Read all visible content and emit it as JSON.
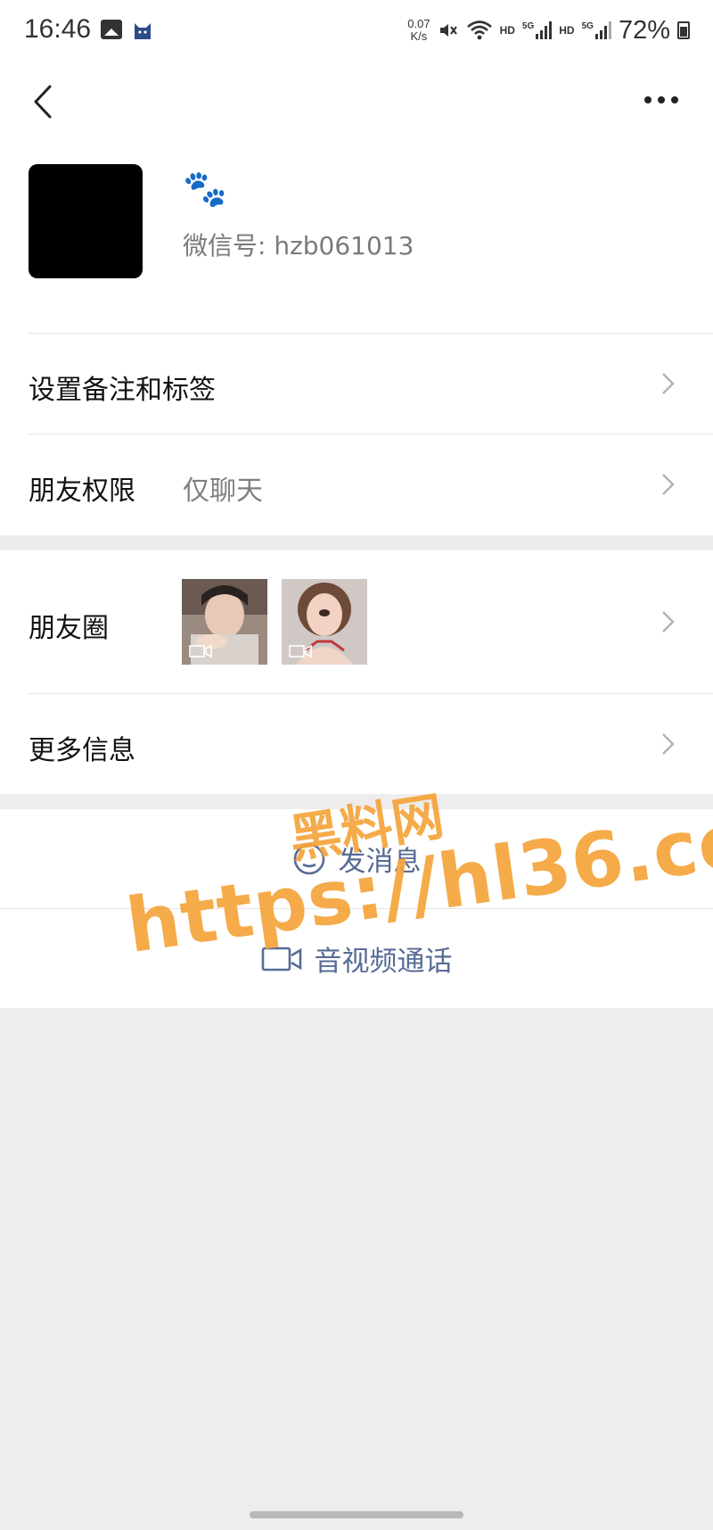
{
  "status_bar": {
    "time": "16:46",
    "net_speed_value": "0.07",
    "net_speed_unit": "K/s",
    "hd1": "HD",
    "sig1": "5G",
    "hd2": "HD",
    "sig2": "5G",
    "battery": "72%"
  },
  "topbar": {
    "back_icon": "back-chevron-icon",
    "more_icon": "more-dots-icon"
  },
  "profile": {
    "nickname_emoji": "🐾",
    "wechat_id": "微信号: hzb061013"
  },
  "rows": {
    "remark_label": "设置备注和标签",
    "permission_label": "朋友权限",
    "permission_value": "仅聊天",
    "moments_label": "朋友圈",
    "more_info_label": "更多信息"
  },
  "actions": {
    "send_message": "发消息",
    "video_call": "音视频通话"
  },
  "watermark": {
    "line1": "黑料网",
    "line2": "https://hl36.co"
  },
  "colors": {
    "link_blue": "#576b95",
    "watermark_orange": "#f5a43a",
    "page_bg": "#ededed"
  }
}
